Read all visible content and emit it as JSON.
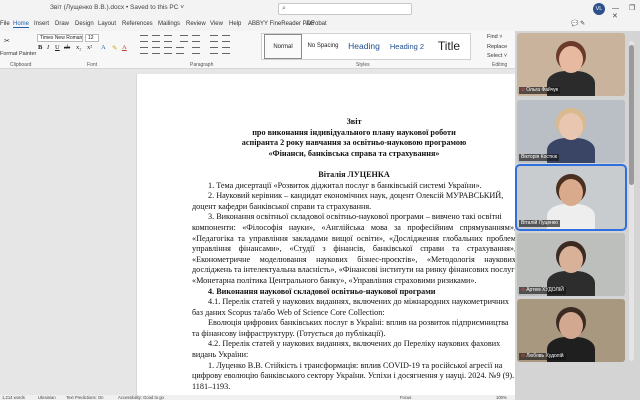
{
  "window": {
    "doc_title": "Звіт (Лущенко В.В.).docx • Saved to this PC ˅",
    "search_icon": "search-icon",
    "user_initials": "VL",
    "controls": "— ❐ ✕"
  },
  "tabs": [
    "File",
    "Home",
    "Insert",
    "Draw",
    "Design",
    "Layout",
    "References",
    "Mailings",
    "Review",
    "View",
    "Help",
    "ABBYY FineReader PDF",
    "Acrobat"
  ],
  "tabs_right": "💬 ✎",
  "ribbon": {
    "clipboard_text": [
      "✂",
      "Format Painter"
    ],
    "font_name": "Times New Roman",
    "font_size": "12",
    "format_buttons": [
      "B",
      "I",
      "U",
      "ab",
      "x₂",
      "x²"
    ],
    "font_color_buttons": [
      "A",
      "✎",
      "A"
    ],
    "groups": {
      "clipboard": "Clipboard",
      "font": "Font",
      "paragraph": "Paragraph",
      "styles": "Styles",
      "editing": "Editing"
    },
    "styles": [
      {
        "label": "Normal"
      },
      {
        "label": "No Spacing"
      },
      {
        "label": "Heading"
      },
      {
        "label": "Heading 2"
      },
      {
        "label": "Title"
      }
    ],
    "editing": [
      "Find ˅",
      "Replace",
      "Select ˅"
    ]
  },
  "document": {
    "title_lines": [
      "Звіт",
      "про виконання індивідуального плану наукової роботи",
      "аспіранта 2 року навчання за освітньо-науковою програмою",
      "«Фінанси, банківська справа та страхування»"
    ],
    "author": "Віталія ЛУЦЕНКА",
    "p1": "1. Тема дисертації «Розвиток діджитал послуг в банківській системі України».",
    "p2a": "2. Науковий керівник – кандидат економічних наук, доцент Олексій МУРАВСЬКИЙ,",
    "p2b": "доцент кафедри банківської справи та страхування.",
    "p3a": "3. Виконання освітньої складової освітньо-наукової програми – вивчено такі освітні",
    "p3b": "компоненти: «Філософія науки», «Англійська мова за професійним спрямуванням»,",
    "p3c": "«Педагогіка та управління закладами вищої освіти», «Дослідження глобальних проблем",
    "p3d": "управління фінансами», «Студії з фінансів, банківської справи та страхування»,",
    "p3e": "«Економетричне моделювання наукових бізнес-проєктів», «Методологія наукових",
    "p3f": "досліджень та інтелектуальна власність», «Фінансові інститути на ринку фінансових послуг»,",
    "p3g": "«Монетарна політика Центрального банку», «Управління страховими ризиками».",
    "p4": "4. Виконання наукової складової освітньо-наукової програми",
    "p41a": "4.1. Перелік статей у наукових виданнях, включених до міжнародних наукометричних",
    "p41b": "баз даних Scopus та/або Web of Science Core Collection:",
    "p41c": "Еволюція цифрових банківських послуг в Україні: вплив на розвиток підприємництва",
    "p41d": "та фінансову інфраструктуру. (Готується до публікації).",
    "p42a": "4.2. Перелік статей у наукових виданнях, включених до Переліку наукових фахових",
    "p42b": "видань України:",
    "ref1a": "1. Луценко В.В. Стійкість і трансформація: вплив COVID-19 та російської агресії на",
    "ref1b": "цифрову еволюцію банківського сектору України. Успіхи і досягнення у науці. 2024. №9 (9). С.",
    "ref1c": "1181–1193."
  },
  "status": {
    "words": "1,214 words",
    "language": "Ukrainian",
    "predictions": "Text Predictions: On",
    "accessibility": "Accessibility: Good to go",
    "focus": "Focus",
    "zoom": "100%"
  },
  "participants": [
    {
      "name": "Ольга Файчук",
      "mic_muted": true,
      "active": false,
      "bg": "#c9b39c",
      "skin": "#e7b9a0",
      "hair": "#6a3b2a",
      "shirt": "#2b2b2b"
    },
    {
      "name": "Вікторія Костюк",
      "mic_muted": false,
      "active": false,
      "bg": "#b9bfc4",
      "skin": "#e8c6b0",
      "hair": "#d9b98e",
      "shirt": "#3a4566"
    },
    {
      "name": "Віталій Луценко",
      "mic_muted": false,
      "active": true,
      "bg": "#c8cccf",
      "skin": "#d9ab8c",
      "hair": "#4a3020",
      "shirt": "#eeeeee"
    },
    {
      "name": "Артем ХУДОЛІЙ",
      "mic_muted": true,
      "active": false,
      "bg": "#bdbfbd",
      "skin": "#d8b198",
      "hair": "#3b2a20",
      "shirt": "#2d2d2d"
    },
    {
      "name": "Любовь Худолій",
      "mic_muted": true,
      "active": false,
      "bg": "#a89880",
      "skin": "#d2a890",
      "hair": "#3a2a22",
      "shirt": "#1f1f1f"
    }
  ]
}
